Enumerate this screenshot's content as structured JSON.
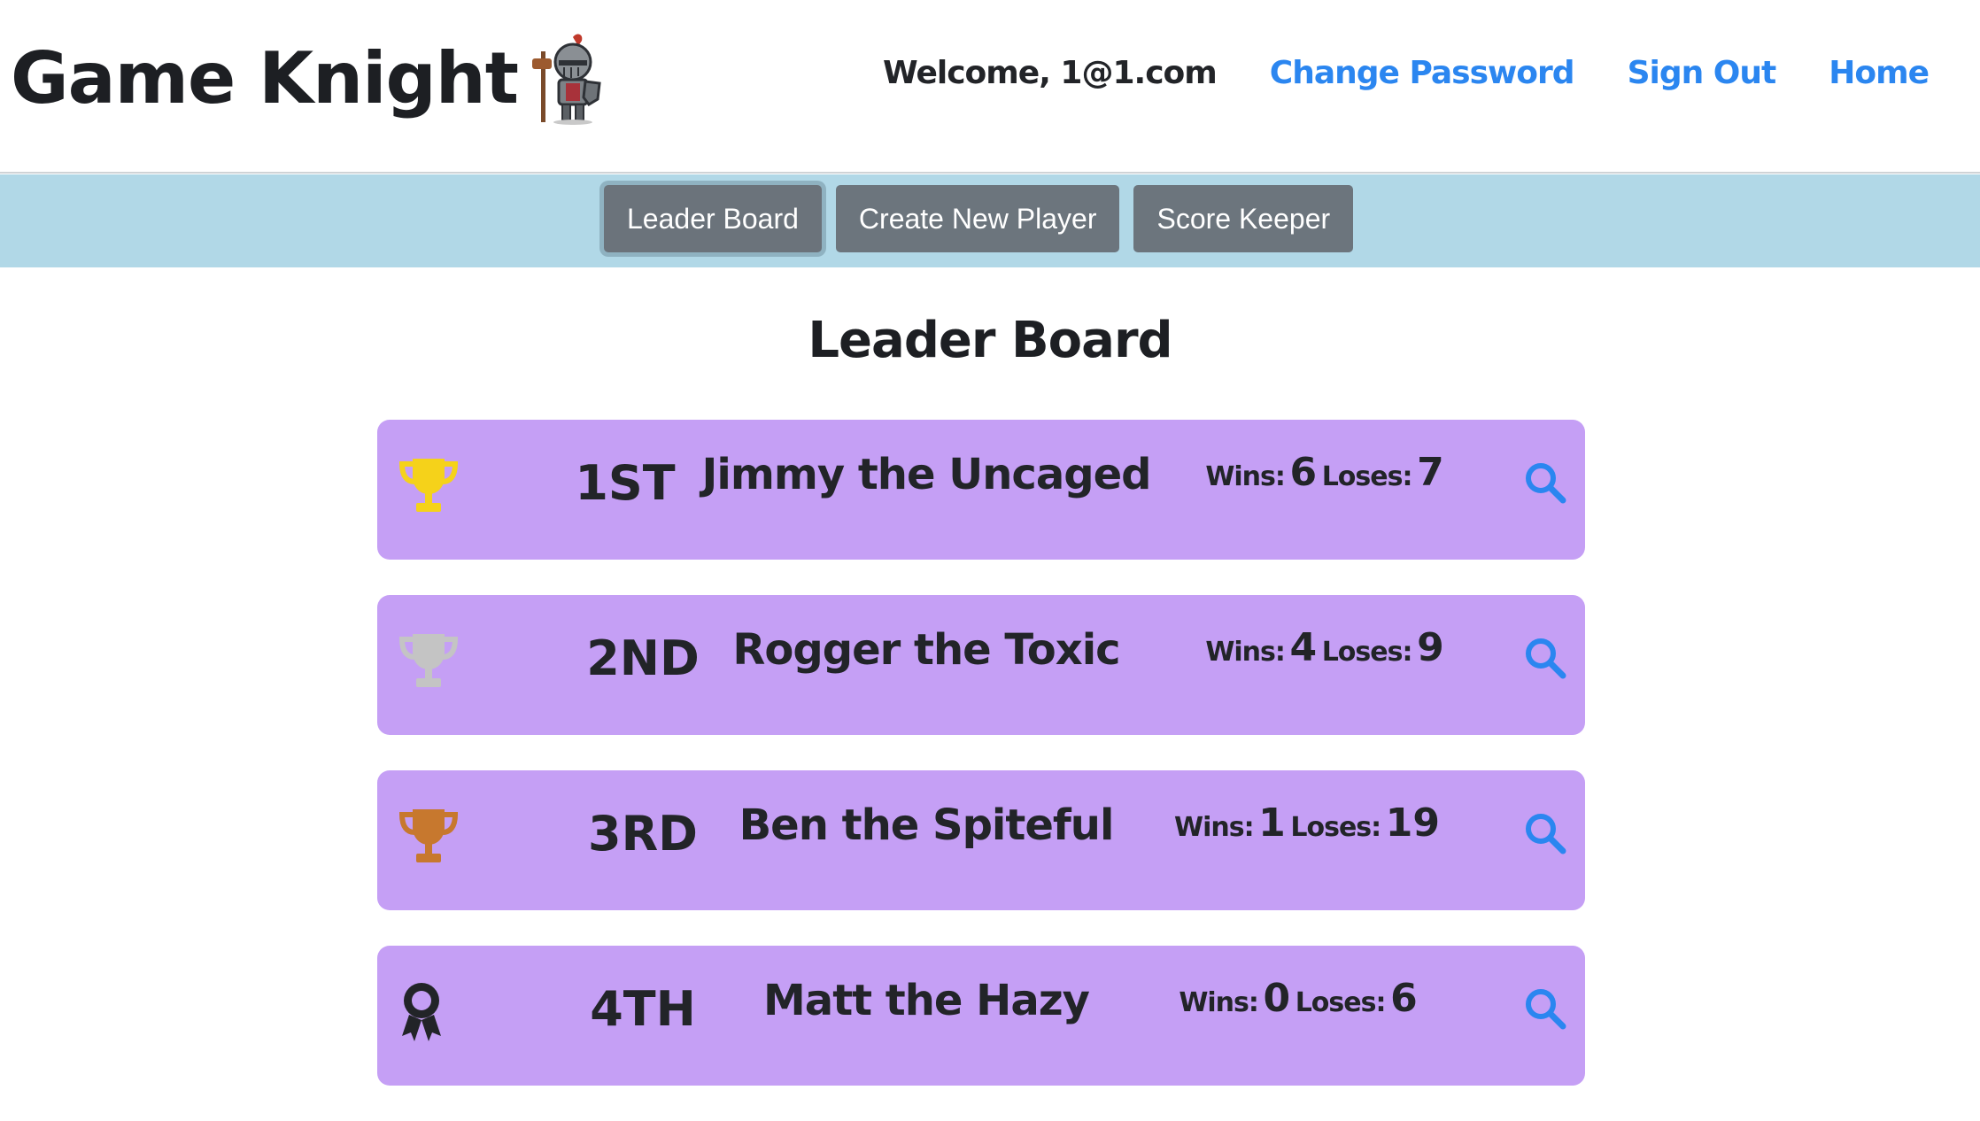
{
  "header": {
    "brand_title": "Game Knight",
    "welcome": "Welcome, 1@1.com",
    "nav": {
      "change_password": "Change Password",
      "sign_out": "Sign Out",
      "home": "Home"
    }
  },
  "tabs": [
    {
      "label": "Leader Board",
      "active": true
    },
    {
      "label": "Create New Player",
      "active": false
    },
    {
      "label": "Score Keeper",
      "active": false
    }
  ],
  "main": {
    "title": "Leader Board",
    "wins_label": "Wins:",
    "loses_label": "Loses:",
    "rows": [
      {
        "rank": "1ST",
        "name": "Jimmy the Uncaged",
        "wins": "6",
        "loses": "7",
        "icon": "trophy-gold-icon"
      },
      {
        "rank": "2ND",
        "name": "Rogger the Toxic",
        "wins": "4",
        "loses": "9",
        "icon": "trophy-silver-icon"
      },
      {
        "rank": "3RD",
        "name": "Ben the Spiteful",
        "wins": "1",
        "loses": "19",
        "icon": "trophy-bronze-icon"
      },
      {
        "rank": "4TH",
        "name": "Matt the Hazy",
        "wins": "0",
        "loses": "6",
        "icon": "award-ribbon-icon"
      }
    ]
  },
  "colors": {
    "accent_link": "#2b86f0",
    "tabbar_bg": "#b1d8e7",
    "tab_button": "#6c757d",
    "row_bg": "#c59ff5",
    "gold": "#f5d21a",
    "silver": "#c4c4c4",
    "bronze": "#c7782e",
    "text_dark": "#222428"
  }
}
